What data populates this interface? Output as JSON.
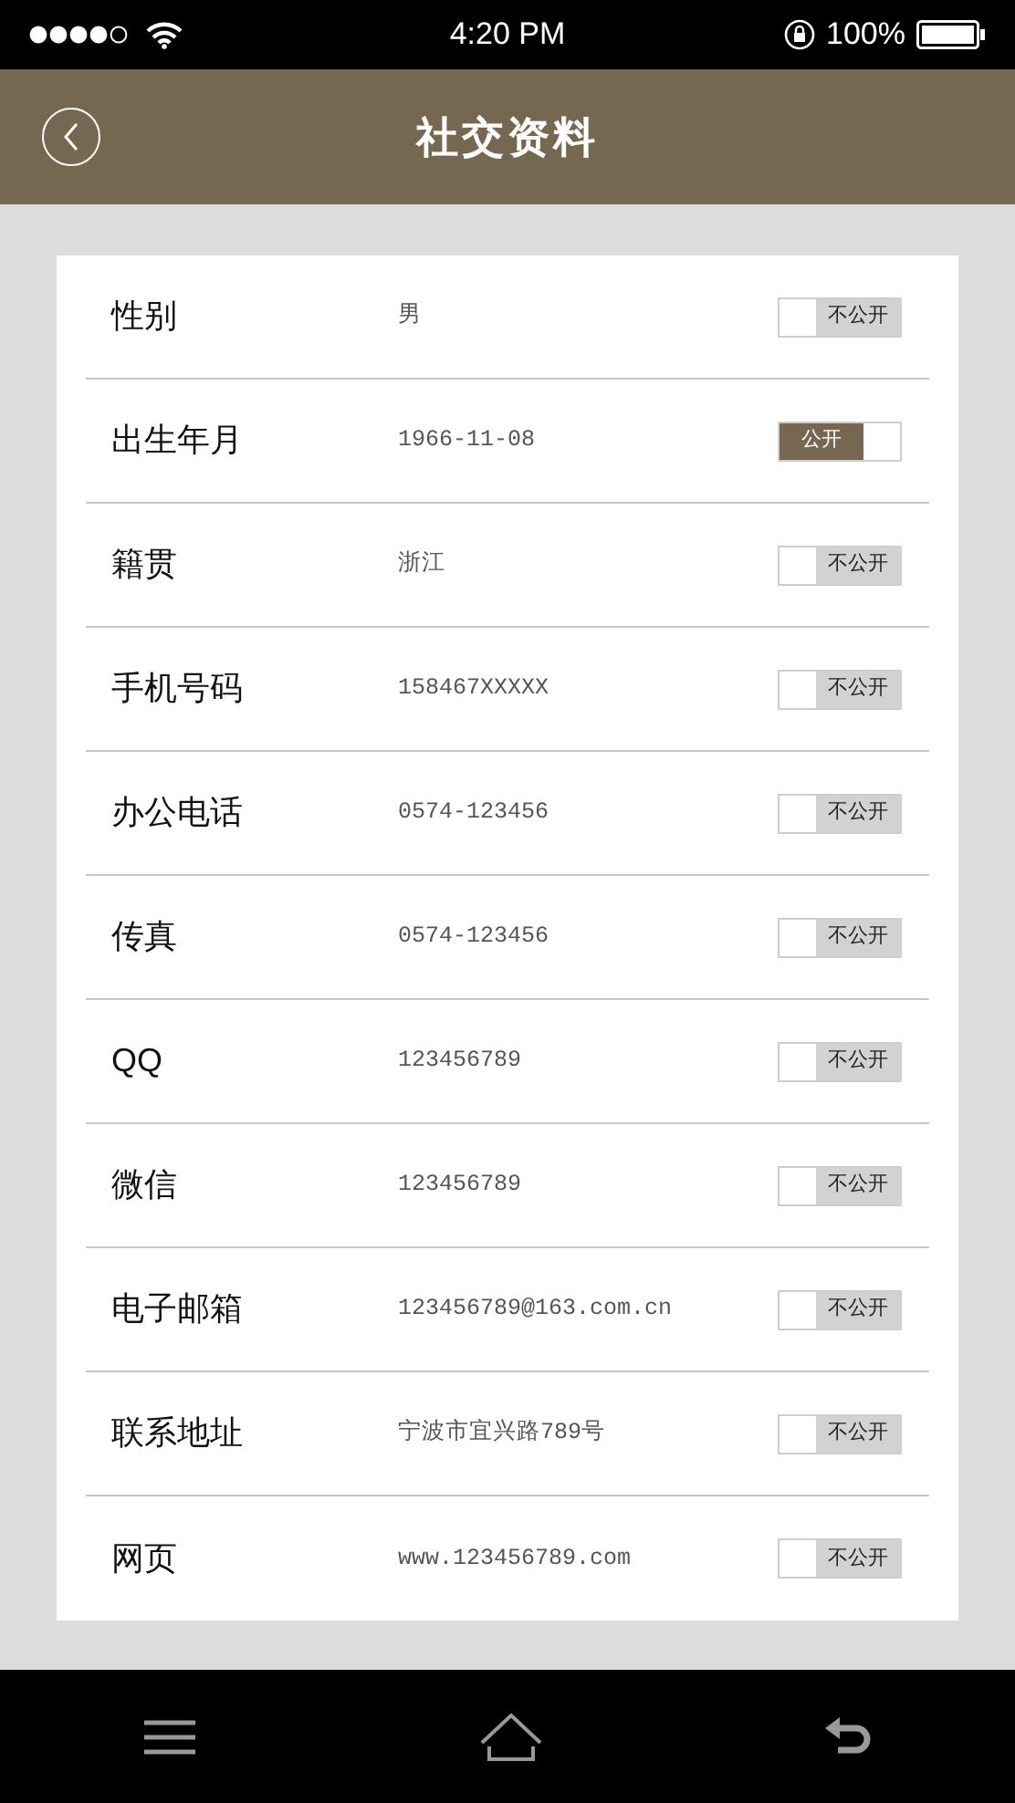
{
  "status_bar": {
    "time": "4:20 PM",
    "battery": "100%"
  },
  "header": {
    "title": "社交资料"
  },
  "rows": [
    {
      "label": "性别",
      "value": "男",
      "public": false,
      "toggle_label": "不公开"
    },
    {
      "label": "出生年月",
      "value": "1966-11-08",
      "public": true,
      "toggle_label": "公开"
    },
    {
      "label": "籍贯",
      "value": "浙江",
      "public": false,
      "toggle_label": "不公开"
    },
    {
      "label": "手机号码",
      "value": "158467XXXXX",
      "public": false,
      "toggle_label": "不公开"
    },
    {
      "label": "办公电话",
      "value": "0574-123456",
      "public": false,
      "toggle_label": "不公开"
    },
    {
      "label": "传真",
      "value": "0574-123456",
      "public": false,
      "toggle_label": "不公开"
    },
    {
      "label": "QQ",
      "value": "123456789",
      "public": false,
      "toggle_label": "不公开"
    },
    {
      "label": "微信",
      "value": "123456789",
      "public": false,
      "toggle_label": "不公开"
    },
    {
      "label": "电子邮箱",
      "value": "123456789@163.com.cn",
      "public": false,
      "toggle_label": "不公开"
    },
    {
      "label": "联系地址",
      "value": "宁波市宜兴路789号",
      "public": false,
      "toggle_label": "不公开"
    },
    {
      "label": "网页",
      "value": "www.123456789.com",
      "public": false,
      "toggle_label": "不公开"
    }
  ]
}
